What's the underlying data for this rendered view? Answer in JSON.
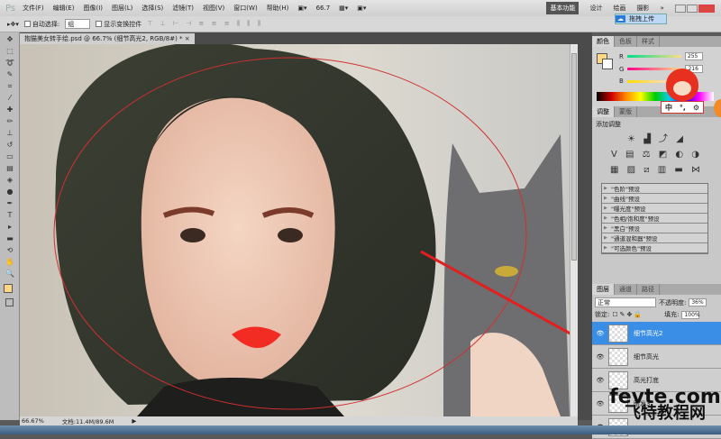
{
  "app": {
    "logo": "Ps"
  },
  "menu": [
    "文件(F)",
    "编辑(E)",
    "图像(I)",
    "图层(L)",
    "选择(S)",
    "滤镜(T)",
    "视图(V)",
    "窗口(W)",
    "帮助(H)"
  ],
  "zoom_select": "66.7",
  "workspaces": [
    "基本功能",
    "设计",
    "绘画",
    "摄影",
    "»"
  ],
  "upload_button": "拖拽上传",
  "options": {
    "auto_select_label": "自动选择:",
    "auto_select_value": "组",
    "show_transform_label": "显示变换控件"
  },
  "document_tab": "抱猫美女转手绘.psd @ 66.7% (细节高光2, RGB/8#) * ×",
  "color_panel": {
    "tabs": [
      "颜色",
      "色板",
      "样式"
    ],
    "channels": [
      {
        "label": "R",
        "value": "255"
      },
      {
        "label": "G",
        "value": "216"
      },
      {
        "label": "B",
        "value": ""
      }
    ],
    "foreground": "#ffd884"
  },
  "adjust_panel": {
    "tabs": [
      "调整",
      "蒙版"
    ],
    "title": "添加调整",
    "presets": [
      "\"色阶\"预设",
      "\"曲线\"预设",
      "\"曝光度\"预设",
      "\"色相/饱和度\"预设",
      "\"黑白\"预设",
      "\"通道混和器\"预设",
      "\"可选颜色\"预设"
    ]
  },
  "layers_panel": {
    "tabs": [
      "图层",
      "通道",
      "路径"
    ],
    "blend_mode": "正常",
    "opacity_label": "不透明度:",
    "opacity": "36%",
    "lock_label": "锁定:",
    "fill_label": "填充:",
    "fill": "100%",
    "layers": [
      {
        "name": "细节高光2",
        "selected": true
      },
      {
        "name": "细节高光",
        "selected": false
      },
      {
        "name": "高光打底",
        "selected": false
      },
      {
        "name": "眼发3",
        "selected": false
      },
      {
        "name": "",
        "selected": false
      }
    ]
  },
  "status": {
    "zoom": "66.67%",
    "doc": "文档:11.4M/89.6M"
  },
  "ime_toolbar": [
    "中",
    "°,",
    "⚙"
  ],
  "watermark": {
    "line1": "fevte.com",
    "line2": "飞特教程网"
  }
}
